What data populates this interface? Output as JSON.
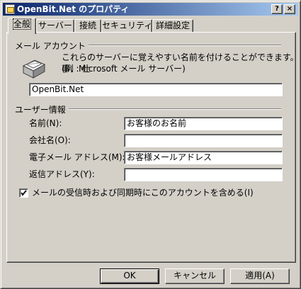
{
  "window": {
    "title": "OpenBit.Net のプロパティ",
    "help_button": "?",
    "close_button": "×"
  },
  "tabs": [
    {
      "label": "全般",
      "active": true
    },
    {
      "label": "サーバー",
      "active": false
    },
    {
      "label": "接続",
      "active": false
    },
    {
      "label": "セキュリティ",
      "active": false
    },
    {
      "label": "詳細設定",
      "active": false
    }
  ],
  "mail_account": {
    "group_label": "メール アカウント",
    "description_line1": "これらのサーバーに覚えやすい名前を付けることができます。(例 : 仕",
    "description_line2": "事、Microsoft メール サーバー)",
    "icon": "mail-account-icon",
    "account_name_value": "OpenBit.Net"
  },
  "user_info": {
    "group_label": "ユーザー情報",
    "fields": [
      {
        "label": "名前(N):",
        "value": "お客様のお名前"
      },
      {
        "label": "会社名(O):",
        "value": ""
      },
      {
        "label": "電子メール アドレス(M):",
        "value": "お客様メールアドレス"
      },
      {
        "label": "返信アドレス(Y):",
        "value": ""
      }
    ]
  },
  "include_on_sync": {
    "label": "メールの受信時および同期時にこのアカウントを含める(I)",
    "checked": true
  },
  "buttons": {
    "ok": "OK",
    "cancel": "キャンセル",
    "apply": "適用(A)"
  }
}
